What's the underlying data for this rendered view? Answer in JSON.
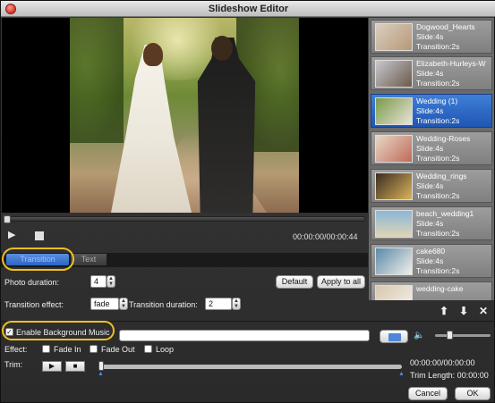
{
  "window": {
    "title": "Slideshow Editor"
  },
  "player": {
    "timecode": "00:00:00/00:00:44"
  },
  "tabs": [
    {
      "label": "Transition"
    },
    {
      "label": "Text"
    }
  ],
  "settings": {
    "photo_duration_label": "Photo duration:",
    "photo_duration_value": "4",
    "transition_effect_label": "Transition effect:",
    "transition_effect_value": "fade",
    "transition_duration_label": "Transition duration:",
    "transition_duration_value": "2",
    "default_button": "Default",
    "apply_all_button": "Apply to all"
  },
  "music": {
    "enable_label": "Enable Background Music",
    "enabled": true,
    "effect_label": "Effect:",
    "fade_in_label": "Fade In",
    "fade_out_label": "Fade Out",
    "loop_label": "Loop",
    "trim_label": "Trim:",
    "trim_time": "00:00:00/00:00:00",
    "trim_length": "Trim Length: 00:00:00"
  },
  "slides": [
    {
      "name": "Dogwood_Hearts",
      "slide": "Slide:4s",
      "transition": "Transition:2s",
      "selected": false,
      "thumb_colors": [
        "#d8cfc0",
        "#b89878"
      ]
    },
    {
      "name": "Elizabeth-Hurleys-W",
      "slide": "Slide:4s",
      "transition": "Transition:2s",
      "selected": false,
      "thumb_colors": [
        "#c8c8d0",
        "#6a5a4a"
      ]
    },
    {
      "name": "Wedding (1)",
      "slide": "Slide:4s",
      "transition": "Transition:2s",
      "selected": true,
      "thumb_colors": [
        "#7a9a48",
        "#e8e4da"
      ]
    },
    {
      "name": "Wedding-Roses",
      "slide": "Slide:4s",
      "transition": "Transition:2s",
      "selected": false,
      "thumb_colors": [
        "#e6d8c8",
        "#c06a58"
      ]
    },
    {
      "name": "Wedding_rings",
      "slide": "Slide:4s",
      "transition": "Transition:2s",
      "selected": false,
      "thumb_colors": [
        "#3a2c22",
        "#d9b45a"
      ]
    },
    {
      "name": "beach_wedding1",
      "slide": "Slide:4s",
      "transition": "Transition:2s",
      "selected": false,
      "thumb_colors": [
        "#8ab8d8",
        "#e0d4b4"
      ]
    },
    {
      "name": "cake680",
      "slide": "Slide:4s",
      "transition": "Transition:2s",
      "selected": false,
      "thumb_colors": [
        "#5a8aa8",
        "#f2f0ea"
      ]
    },
    {
      "name": "wedding-cake",
      "slide": "",
      "transition": "",
      "selected": false,
      "thumb_colors": [
        "#d8c8b0",
        "#f4f0e8"
      ]
    }
  ],
  "footer": {
    "cancel_button": "Cancel",
    "ok_button": "OK"
  },
  "colors": {
    "highlight": "#f0c020",
    "selection": "#2d63c4"
  }
}
